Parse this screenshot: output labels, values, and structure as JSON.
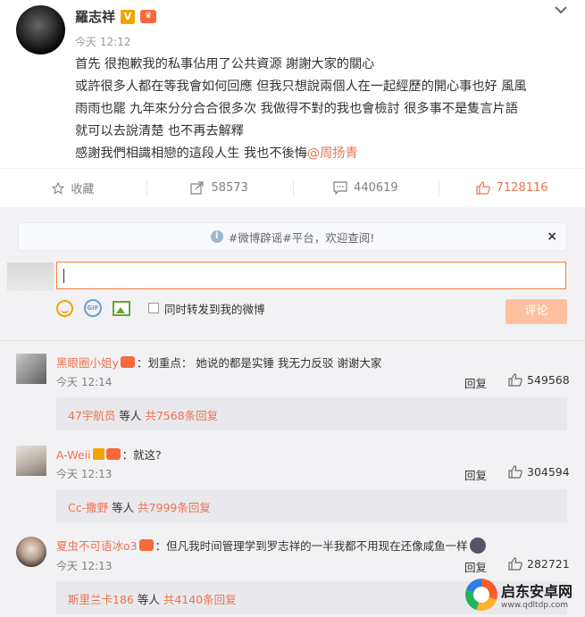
{
  "post": {
    "author": "羅志祥",
    "badge_v": "V",
    "time": "今天 12:12",
    "lines": [
      "首先 很抱歉我的私事佔用了公共資源 謝謝大家的關心",
      "或許很多人都在等我會如何回應 但我只想說兩個人在一起經歷的開心事也好 風風",
      "雨雨也罷 九年來分分合合很多次 我做得不對的我也會檢討 很多事不是隻言片語",
      "就可以去說清楚 也不再去解釋"
    ],
    "last_line_text": "感謝我們相識相戀的這段人生 我也不後悔",
    "mention": "@周扬青"
  },
  "actions": {
    "favorite_label": "收藏",
    "repost_count": "58573",
    "comment_count": "440619",
    "like_count": "7128116"
  },
  "notice": {
    "text": "#微博辟谣#平台，欢迎查阅!",
    "close": "×"
  },
  "composer": {
    "forward_label": "同时转发到我的微博",
    "submit_label": "评论",
    "gif_label": "GIF"
  },
  "comments": [
    {
      "user": "黑眼圈小姐y",
      "text": "：划重点：  她说的都是实锤 我无力反驳 谢谢大家",
      "time": "今天 12:14",
      "reply_label": "回复",
      "likes": "549568",
      "sub_user": "47宇航员",
      "sub_mid": " 等人 ",
      "sub_count": "共7568条回复"
    },
    {
      "user": "A-Weii",
      "text": "：就这?",
      "time": "今天 12:13",
      "reply_label": "回复",
      "likes": "304594",
      "sub_user": "Cc-撒野",
      "sub_mid": " 等人 ",
      "sub_count": "共7999条回复"
    },
    {
      "user": "夏虫不可语冰o3",
      "text": "：但凡我时间管理学到罗志祥的一半我都不用现在还像咸鱼一样",
      "time": "今天 12:13",
      "reply_label": "回复",
      "likes": "282721",
      "sub_user": "斯里兰卡186",
      "sub_mid": " 等人 ",
      "sub_count": "共4140条回复"
    }
  ],
  "watermark": {
    "title": "启东安卓网",
    "url": "www.qdltdp.com"
  },
  "colors": {
    "accent": "#eb7350",
    "input_border": "#fa7d3c",
    "submit_disabled": "#ffc09f",
    "comment_bg": "#f2f2f5"
  },
  "icons": [
    "chevron-down-icon",
    "star-icon",
    "share-icon",
    "comment-icon",
    "like-icon",
    "info-icon",
    "emoji-icon",
    "gif-icon",
    "image-icon",
    "watermark-logo-icon"
  ]
}
